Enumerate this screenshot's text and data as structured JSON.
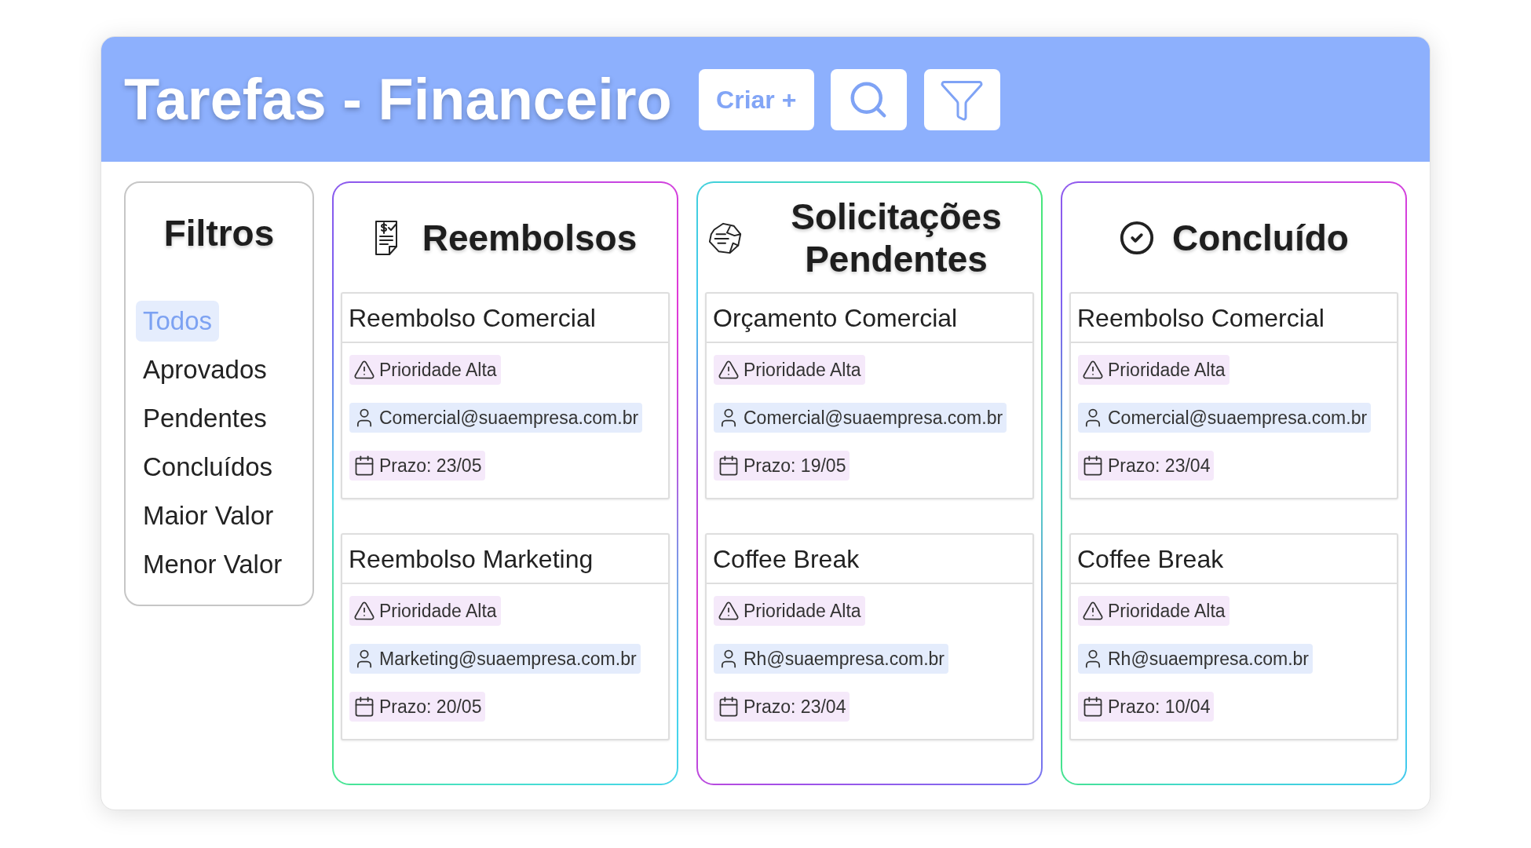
{
  "header": {
    "title": "Tarefas - Financeiro",
    "create_button": "Criar +"
  },
  "filters": {
    "title": "Filtros",
    "items": [
      {
        "label": "Todos",
        "selected": true
      },
      {
        "label": "Aprovados",
        "selected": false
      },
      {
        "label": "Pendentes",
        "selected": false
      },
      {
        "label": "Concluídos",
        "selected": false
      },
      {
        "label": "Maior Valor",
        "selected": false
      },
      {
        "label": "Menor Valor",
        "selected": false
      }
    ]
  },
  "columns": [
    {
      "title": "Reembolsos",
      "cards": [
        {
          "title": "Reembolso Comercial",
          "priority": "Prioridade Alta",
          "assignee": "Comercial@suaempresa.com.br",
          "deadline": "Prazo: 23/05"
        },
        {
          "title": "Reembolso Marketing",
          "priority": "Prioridade Alta",
          "assignee": "Marketing@suaempresa.com.br",
          "deadline": "Prazo: 20/05"
        }
      ]
    },
    {
      "title": "Solicitações Pendentes",
      "cards": [
        {
          "title": "Orçamento Comercial",
          "priority": "Prioridade Alta",
          "assignee": "Comercial@suaempresa.com.br",
          "deadline": "Prazo: 19/05"
        },
        {
          "title": "Coffee Break",
          "priority": "Prioridade Alta",
          "assignee": "Rh@suaempresa.com.br",
          "deadline": "Prazo: 23/04"
        }
      ]
    },
    {
      "title": "Concluído",
      "cards": [
        {
          "title": "Reembolso Comercial",
          "priority": "Prioridade Alta",
          "assignee": "Comercial@suaempresa.com.br",
          "deadline": "Prazo: 23/04"
        },
        {
          "title": "Coffee Break",
          "priority": "Prioridade Alta",
          "assignee": "Rh@suaempresa.com.br",
          "deadline": "Prazo: 10/04"
        }
      ]
    }
  ]
}
